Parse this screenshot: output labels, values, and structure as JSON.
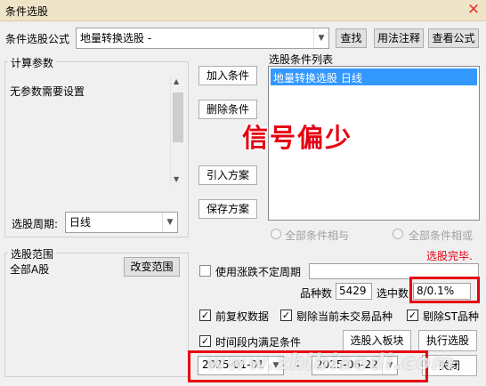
{
  "window": {
    "title": "条件选股",
    "close_glyph": "✕"
  },
  "formula": {
    "label": "条件选股公式",
    "value": "地量转换选股  -",
    "btn_find": "查找",
    "btn_usage": "用法注释",
    "btn_view": "查看公式"
  },
  "params": {
    "group_title": "计算参数",
    "text": "无参数需要设置",
    "period_label": "选股周期:",
    "period_value": "日线"
  },
  "actions": {
    "add": "加入条件",
    "remove": "删除条件",
    "import": "引入方案",
    "save": "保存方案"
  },
  "conditions": {
    "title": "选股条件列表",
    "items": [
      "地量转换选股  日线"
    ]
  },
  "overlay": {
    "text": "信号偏少"
  },
  "radios": {
    "all_and": "全部条件相与",
    "all_or": "全部条件相或"
  },
  "status": {
    "text": "选股完毕."
  },
  "range": {
    "group_title": "选股范围",
    "value": "全部A股",
    "change_btn": "改变范围"
  },
  "options": {
    "variable_period": "使用涨跌不定周期",
    "count_label": "品种数",
    "count_value": "5429",
    "selected_label": "选中数",
    "selected_value": "8/0.1%",
    "forward_adjust": "前复权数据",
    "exclude_untraded": "剔除当前未交易品种",
    "exclude_st": "剔除ST品种",
    "time_range": "时间段内满足条件"
  },
  "dates": {
    "start": "2025-01-01",
    "end": "2025-06-22",
    "sep": "-"
  },
  "bottom": {
    "to_block": "选股入板块",
    "run": "执行选股",
    "close": "关闭"
  },
  "watermark": "www.zhibiaodi.com",
  "icons": {
    "dropdown": "▼",
    "scroll_up": "▲",
    "scroll_down": "▼",
    "check": "✓"
  },
  "colors": {
    "title_bg": "#f0e4c8",
    "highlight": "#e60012",
    "selection": "#3399ff",
    "close": "#e23a32"
  }
}
